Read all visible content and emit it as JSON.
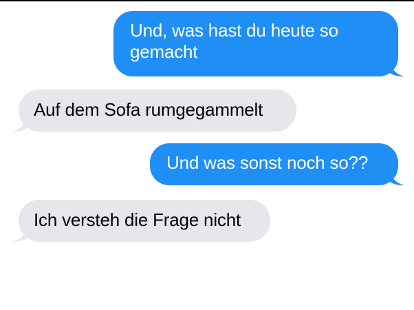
{
  "messages": [
    {
      "direction": "outgoing",
      "text": "Und, was hast du heute so gemacht"
    },
    {
      "direction": "incoming",
      "text": "Auf dem Sofa rumgegammelt"
    },
    {
      "direction": "outgoing",
      "text": "Und was sonst noch so??"
    },
    {
      "direction": "incoming",
      "text": "Ich versteh die Frage nicht"
    }
  ],
  "colors": {
    "outgoing_bubble": "#1f8ff5",
    "incoming_bubble": "#e6e6eb",
    "background": "#ffffff"
  }
}
